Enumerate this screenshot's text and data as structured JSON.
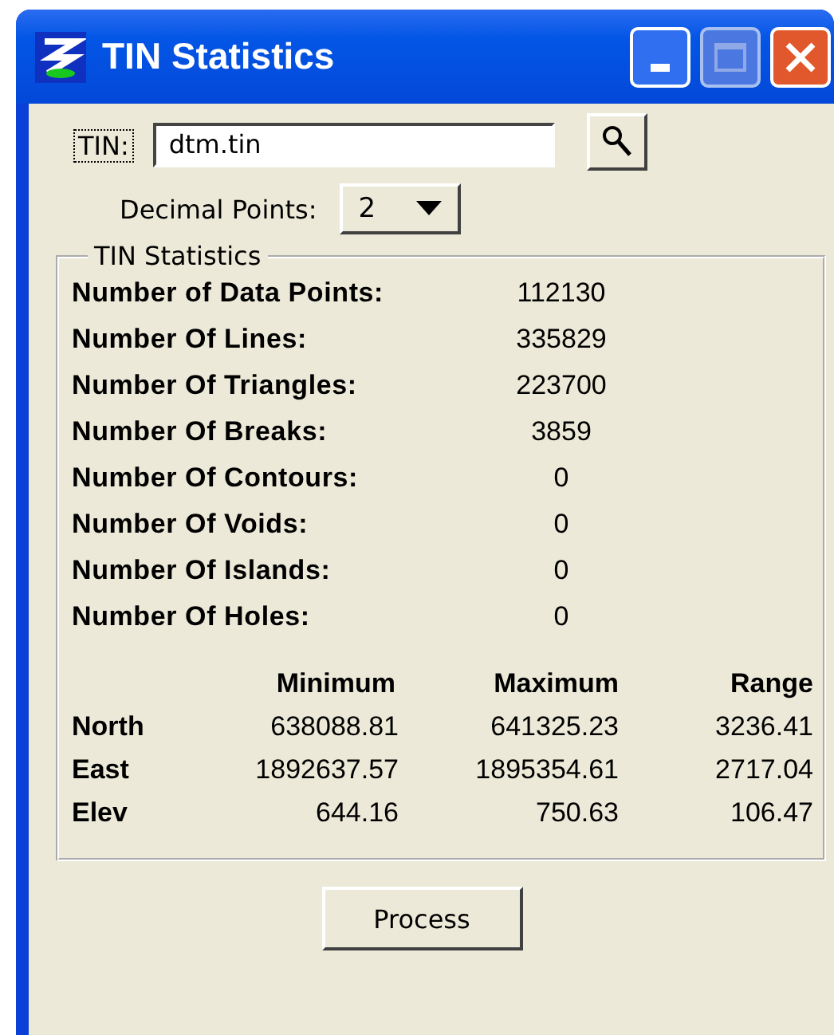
{
  "window": {
    "title": "TIN Statistics"
  },
  "tin": {
    "label": "TIN:",
    "value": "dtm.tin"
  },
  "decimal_points": {
    "label": "Decimal Points:",
    "value": "2"
  },
  "group": {
    "title": "TIN Statistics",
    "stats": [
      {
        "label": "Number of Data Points:",
        "value": "112130"
      },
      {
        "label": "Number Of Lines:",
        "value": "335829"
      },
      {
        "label": "Number Of Triangles:",
        "value": "223700"
      },
      {
        "label": "Number Of Breaks:",
        "value": "3859"
      },
      {
        "label": "Number Of Contours:",
        "value": "0"
      },
      {
        "label": "Number Of Voids:",
        "value": "0"
      },
      {
        "label": "Number Of Islands:",
        "value": "0"
      },
      {
        "label": "Number Of Holes:",
        "value": "0"
      }
    ],
    "table": {
      "columns": [
        "Minimum",
        "Maximum",
        "Range"
      ],
      "rows": [
        {
          "label": "North",
          "values": [
            "638088.81",
            "641325.23",
            "3236.41"
          ]
        },
        {
          "label": "East",
          "values": [
            "1892637.57",
            "1895354.61",
            "2717.04"
          ]
        },
        {
          "label": "Elev",
          "values": [
            "644.16",
            "750.63",
            "106.47"
          ]
        }
      ]
    }
  },
  "buttons": [
    "Process"
  ]
}
